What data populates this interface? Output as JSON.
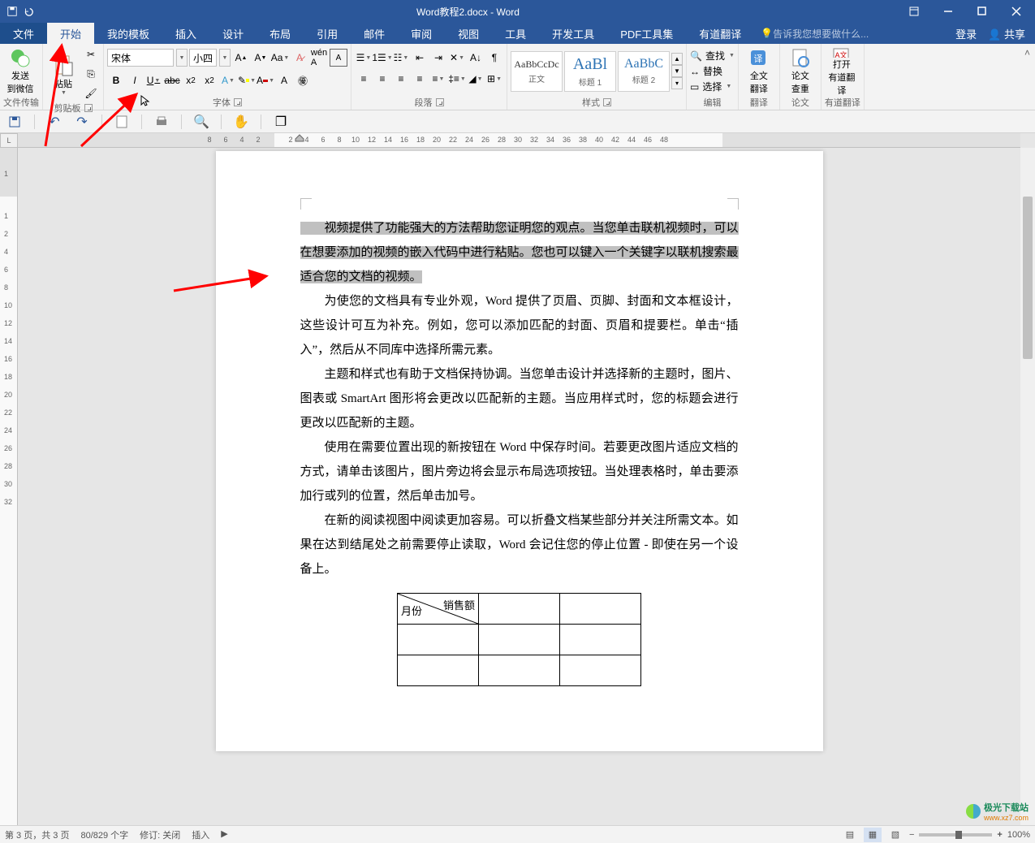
{
  "title": "Word教程2.docx - Word",
  "menu": {
    "file": "文件",
    "home": "开始",
    "templates": "我的模板",
    "insert": "插入",
    "design": "设计",
    "layout": "布局",
    "references": "引用",
    "mail": "邮件",
    "review": "审阅",
    "view": "视图",
    "tools": "工具",
    "devtools": "开发工具",
    "pdf": "PDF工具集",
    "youdao": "有道翻译",
    "tell_me": "告诉我您想要做什么...",
    "login": "登录",
    "share": "共享"
  },
  "ribbon": {
    "file_transfer": "文件传输",
    "send_wechat": "发送\n到微信",
    "clipboard": "剪贴板",
    "paste": "粘贴",
    "font": "字体",
    "font_name": "宋体",
    "font_size": "小四",
    "paragraph": "段落",
    "styles": "样式",
    "style_normal": "正文",
    "style_preview1": "AaBbCcDc",
    "style_h1": "标题 1",
    "style_preview2": "AaBl",
    "style_h2": "标题 2",
    "style_preview3": "AaBbC",
    "edit": "编辑",
    "find": "查找",
    "replace": "替换",
    "select": "选择",
    "translate": "翻译",
    "full_translate": "全文\n翻译",
    "thesis": "论文",
    "thesis_check": "论文\n查重",
    "youdao_trans_grp": "有道翻译",
    "open_youdao": "打开\n有道翻译"
  },
  "ruler_h_labels": [
    "8",
    "6",
    "4",
    "2",
    "2",
    "4",
    "6",
    "8",
    "10",
    "12",
    "14",
    "16",
    "18",
    "20",
    "22",
    "24",
    "26",
    "28",
    "30",
    "32",
    "34",
    "36",
    "38",
    "40",
    "42",
    "44",
    "46",
    "48"
  ],
  "ruler_h_positions": [
    236,
    256,
    276,
    296,
    336,
    356,
    376,
    396,
    416,
    436,
    456,
    476,
    496,
    516,
    536,
    556,
    576,
    596,
    616,
    636,
    656,
    676,
    696,
    716,
    736,
    756,
    776,
    796
  ],
  "ruler_h_shade_end": 316,
  "ruler_h_shade_right_start": 868,
  "ruler_v_labels": [
    "1",
    "1",
    "2",
    "4",
    "6",
    "8",
    "10",
    "12",
    "14",
    "16",
    "18",
    "20",
    "22",
    "24",
    "26",
    "28",
    "30",
    "32"
  ],
  "ruler_v_positions": [
    32,
    84,
    106,
    128,
    150,
    172,
    194,
    216,
    238,
    260,
    282,
    304,
    326,
    348,
    370,
    392,
    414,
    436
  ],
  "doc": {
    "p1_sel": "视频提供了功能强大的方法帮助您证明您的观点。当您单击联机视频时，可以在想要添加的视频的嵌入代码中进行粘贴。您也可以键入一个关键字以联机搜索最适合您的文档的视频。",
    "p2": "为使您的文档具有专业外观，Word 提供了页眉、页脚、封面和文本框设计，这些设计可互为补充。例如，您可以添加匹配的封面、页眉和提要栏。单击“插入”，然后从不同库中选择所需元素。",
    "p3": "主题和样式也有助于文档保持协调。当您单击设计并选择新的主题时，图片、图表或 SmartArt 图形将会更改以匹配新的主题。当应用样式时，您的标题会进行更改以匹配新的主题。",
    "p4": "使用在需要位置出现的新按钮在 Word 中保存时间。若要更改图片适应文档的方式，请单击该图片，图片旁边将会显示布局选项按钮。当处理表格时，单击要添加行或列的位置，然后单击加号。",
    "p5": "在新的阅读视图中阅读更加容易。可以折叠文档某些部分并关注所需文本。如果在达到结尾处之前需要停止读取，Word 会记住您的停止位置 - 即使在另一个设备上。",
    "table_h1": "销售额",
    "table_h2": "月份"
  },
  "status": {
    "page": "第 3 页，共 3 页",
    "words": "80/829 个字",
    "track": "修订: 关闭",
    "insert": "插入",
    "zoom": "100%"
  },
  "watermark": "极光下载站",
  "watermark_url": "www.xz7.com",
  "ruler_corner": "L"
}
